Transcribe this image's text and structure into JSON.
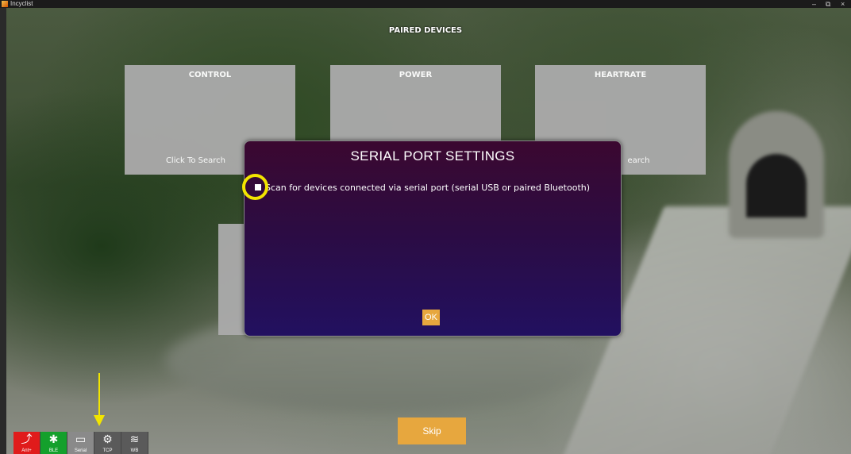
{
  "window": {
    "title": "Incyclist",
    "minimize": "–",
    "maximize": "⧉",
    "close": "×"
  },
  "header": {
    "title": "PAIRED DEVICES"
  },
  "cards": [
    {
      "label": "CONTROL",
      "action": "Click To Search"
    },
    {
      "label": "POWER",
      "action": ""
    },
    {
      "label": "HEARTRATE",
      "action": "earch"
    }
  ],
  "modal": {
    "title": "SERIAL PORT SETTINGS",
    "checkbox_label": "Scan for devices connected via serial port (serial USB or paired Bluetooth)",
    "ok_label": "OK"
  },
  "skip_label": "Skip",
  "toolbar": {
    "items": [
      {
        "icon": "⤴",
        "label": "Ant+"
      },
      {
        "icon": "✱",
        "label": "BLE"
      },
      {
        "icon": "▭",
        "label": "Serial"
      },
      {
        "icon": "⚙",
        "label": "TCP"
      },
      {
        "icon": "≋",
        "label": "WB"
      }
    ]
  },
  "colors": {
    "accent": "#e7a73e",
    "ant": "#e01b1b",
    "ble": "#14a02c",
    "highlight": "#f2e500"
  }
}
